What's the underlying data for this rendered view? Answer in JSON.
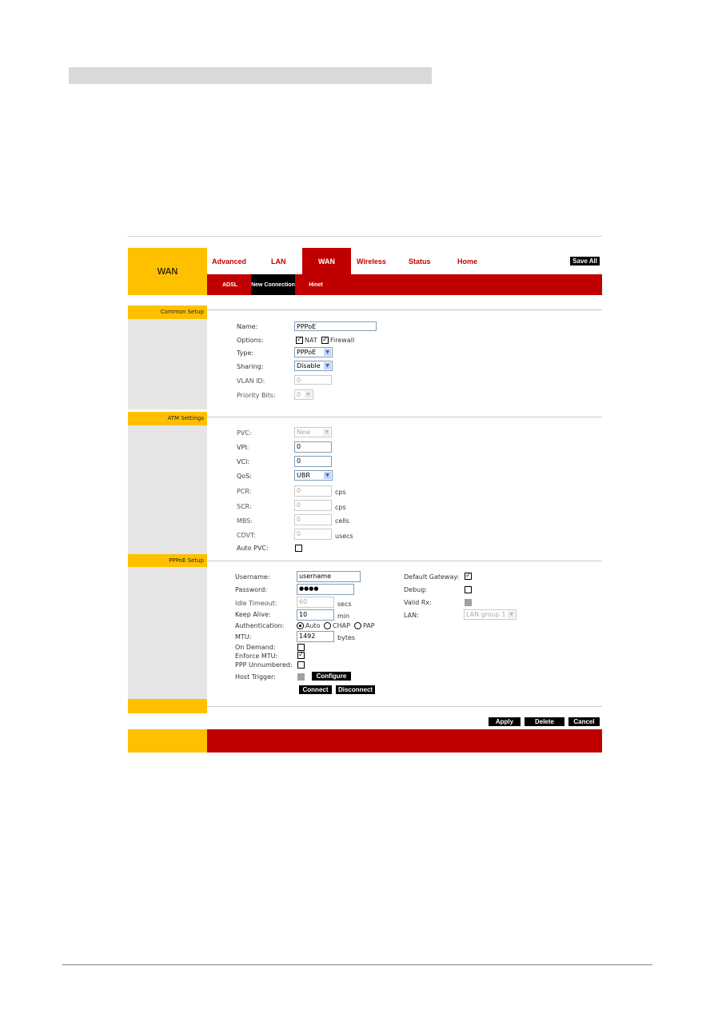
{
  "page_header": {
    "title": "WAN"
  },
  "nav": {
    "tabs": [
      {
        "label": "Advanced",
        "active": false
      },
      {
        "label": "LAN",
        "active": false
      },
      {
        "label": "WAN",
        "active": true
      },
      {
        "label": "Wireless",
        "active": false
      },
      {
        "label": "Status",
        "active": false
      },
      {
        "label": "Home",
        "active": false
      }
    ],
    "save_all": "Save All",
    "subtabs": [
      {
        "label": "ADSL",
        "active": false
      },
      {
        "label": "New Connection",
        "active": true
      },
      {
        "label": "Hinet",
        "active": false
      }
    ]
  },
  "common_setup": {
    "title": "Common Setup",
    "name_label": "Name:",
    "name_value": "PPPoE",
    "options_label": "Options:",
    "nat_label": "NAT",
    "nat_checked": true,
    "firewall_label": "Firewall",
    "firewall_checked": true,
    "type_label": "Type:",
    "type_value": "PPPoE",
    "sharing_label": "Sharing:",
    "sharing_value": "Disable",
    "vlan_label": "VLAN ID:",
    "vlan_value": "0",
    "priority_label": "Priority Bits:",
    "priority_value": "0"
  },
  "atm_settings": {
    "title": "ATM Settings",
    "pvc_label": "PVC:",
    "pvc_value": "New",
    "vpi_label": "VPI:",
    "vpi_value": "0",
    "vci_label": "VCI:",
    "vci_value": "0",
    "qos_label": "QoS:",
    "qos_value": "UBR",
    "pcr_label": "PCR:",
    "pcr_value": "0",
    "pcr_unit": "cps",
    "scr_label": "SCR:",
    "scr_value": "0",
    "scr_unit": "cps",
    "mbs_label": "MBS:",
    "mbs_value": "0",
    "mbs_unit": "cells",
    "cdvt_label": "CDVT:",
    "cdvt_value": "0",
    "cdvt_unit": "usecs",
    "auto_pvc_label": "Auto PVC:",
    "auto_pvc_checked": false
  },
  "pppoe_setup": {
    "title": "PPPoE Setup",
    "username_label": "Username:",
    "username_value": "username",
    "password_label": "Password:",
    "password_value": "●●●●",
    "idle_label": "Idle Timeout:",
    "idle_value": "60",
    "idle_unit": "secs",
    "keepalive_label": "Keep Alive:",
    "keepalive_value": "10",
    "keepalive_unit": "min",
    "auth_label": "Authentication:",
    "auth_options": [
      "Auto",
      "CHAP",
      "PAP"
    ],
    "auth_selected": "Auto",
    "mtu_label": "MTU:",
    "mtu_value": "1492",
    "mtu_unit": "bytes",
    "on_demand_label": "On Demand:",
    "on_demand_checked": false,
    "enforce_mtu_label": "Enforce MTU:",
    "enforce_mtu_checked": true,
    "ppp_unnumbered_label": "PPP Unnumbered:",
    "ppp_unnumbered_checked": false,
    "host_trigger_label": "Host Trigger:",
    "configure_button": "Configure",
    "connect_button": "Connect",
    "disconnect_button": "Disconnect",
    "default_gateway_label": "Default Gateway:",
    "default_gateway_checked": true,
    "debug_label": "Debug:",
    "debug_checked": false,
    "valid_rx_label": "Valid Rx:",
    "lan_label": "LAN:",
    "lan_value": "LAN group 1"
  },
  "actions": {
    "apply": "Apply",
    "delete": "Delete",
    "cancel": "Cancel"
  },
  "colors": {
    "brand_red": "#c00000",
    "brand_yellow": "#ffc000",
    "sidebar_gray": "#e6e6e6"
  }
}
